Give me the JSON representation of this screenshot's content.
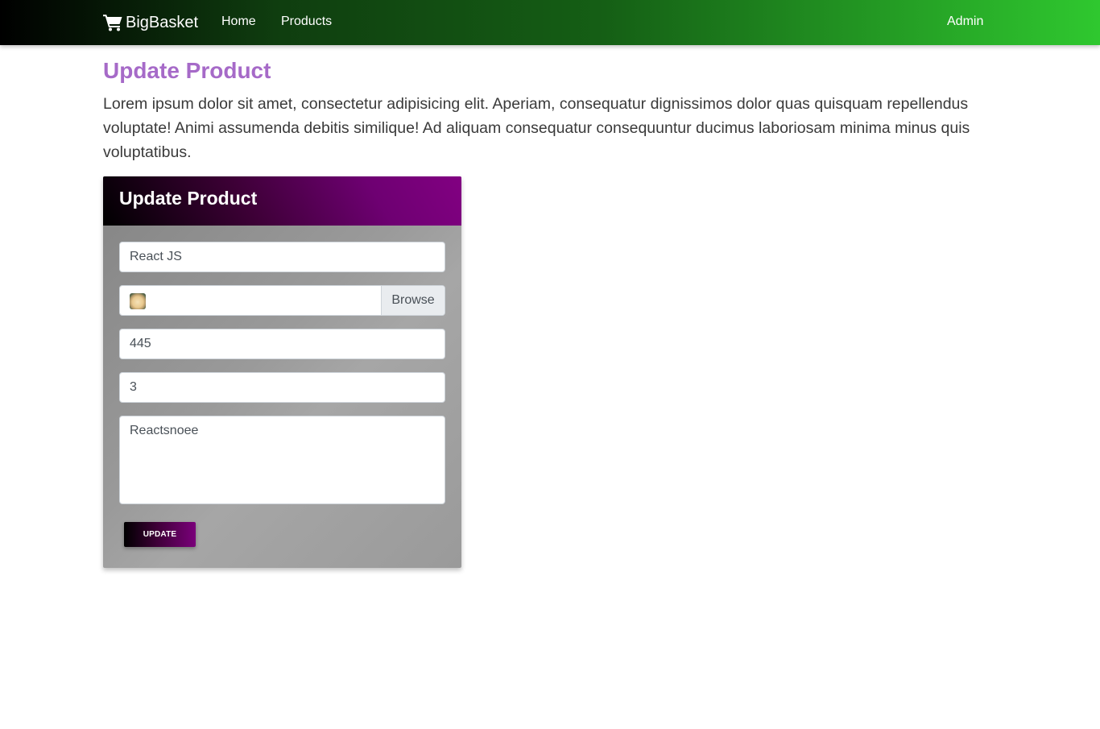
{
  "navbar": {
    "brand": "BigBasket",
    "brand_icon": "shopping-cart-icon",
    "links": [
      "Home",
      "Products"
    ],
    "user": "Admin"
  },
  "page": {
    "title": "Update Product",
    "lead": "Lorem ipsum dolor sit amet, consectetur adipisicing elit. Aperiam, consequatur dignissimos dolor quas quisquam repellendus voluptate! Animi assumenda debitis similique! Ad aliquam consequatur consequuntur ducimus laboriosam minima minus quis voluptatibus."
  },
  "form": {
    "title": "Update Product",
    "name_value": "React JS",
    "file_browse_label": "Browse",
    "price_value": "445",
    "qty_value": "3",
    "description_value": "Reactsnoee",
    "submit_label": "UPDATE"
  },
  "colors": {
    "title_color": "#a66ac8",
    "navbar_gradient_end": "#2fc82f",
    "card_header_accent": "#820082"
  }
}
